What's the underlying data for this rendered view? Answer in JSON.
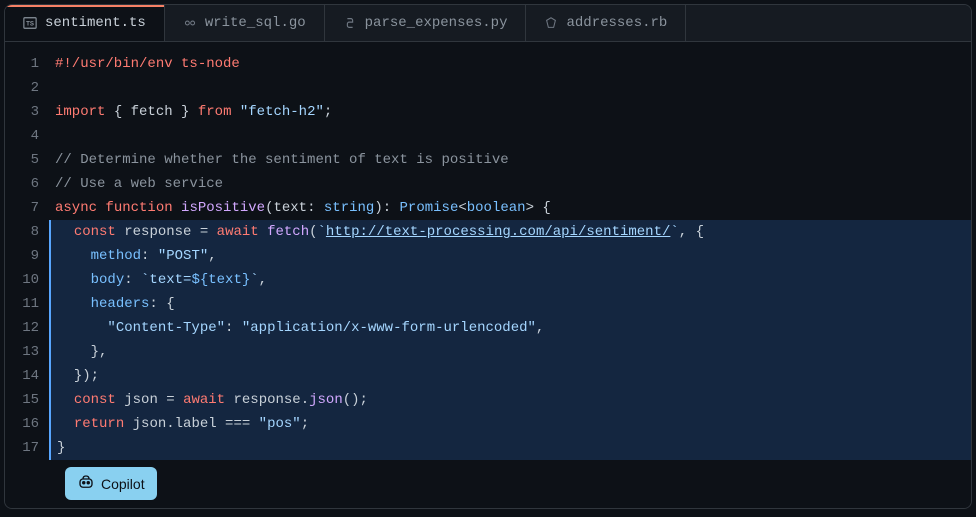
{
  "tabs": [
    {
      "name": "sentiment.ts",
      "icon": "ts",
      "active": true
    },
    {
      "name": "write_sql.go",
      "icon": "go",
      "active": false
    },
    {
      "name": "parse_expenses.py",
      "icon": "py",
      "active": false
    },
    {
      "name": "addresses.rb",
      "icon": "rb",
      "active": false
    }
  ],
  "copilot_label": "Copilot",
  "line_count": 17,
  "code": {
    "shebang": "#!/usr/bin/env ts-node",
    "import_kw": "import",
    "import_braced": "{ fetch }",
    "from_kw": "from",
    "import_module": "\"fetch-h2\"",
    "semi": ";",
    "comment1": "// Determine whether the sentiment of text is positive",
    "comment2": "// Use a web service",
    "async_kw": "async",
    "function_kw": "function",
    "func_name": "isPositive",
    "param_name": "text",
    "colon": ":",
    "param_type": "string",
    "ret_promise": "Promise",
    "ret_boolean": "boolean",
    "open_brace": "{",
    "const_kw": "const",
    "response_var": "response",
    "eq": " = ",
    "await_kw": "await",
    "fetch_call": "fetch",
    "backtick": "`",
    "url": "http://text-processing.com/api/sentiment/",
    "comma": ",",
    "method_key": "method",
    "method_val": "\"POST\"",
    "body_key": "body",
    "body_val_pre": "`text=",
    "body_interp": "${text}",
    "body_val_post": "`",
    "headers_key": "headers",
    "ct_key": "\"Content-Type\"",
    "ct_val": "\"application/x-www-form-urlencoded\"",
    "close_brace": "}",
    "close_paren_semi": ");",
    "json_var": "json",
    "response_ref": "response",
    "json_method": "json",
    "empty_parens": "()",
    "return_kw": "return",
    "label_access": "json.label",
    "triple_eq": " === ",
    "pos_str": "\"pos\""
  }
}
